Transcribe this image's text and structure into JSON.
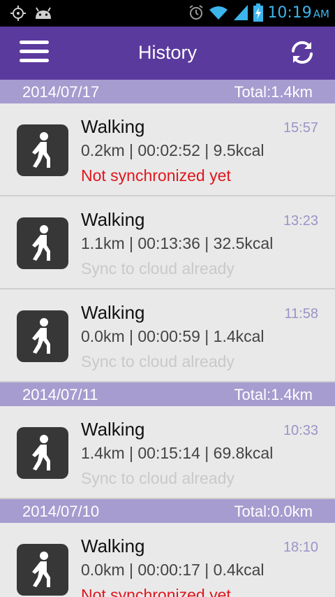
{
  "status_bar": {
    "time": "10:19",
    "ampm": "AM",
    "icons": [
      "gps-icon",
      "android-icon",
      "alarm-icon",
      "wifi-icon",
      "signal-icon",
      "battery-charging-icon"
    ]
  },
  "app_bar": {
    "title": "History",
    "menu_icon": "hamburger-menu-icon",
    "sync_icon": "refresh-sync-icon"
  },
  "colors": {
    "app_bar": "#5b3a9e",
    "day_header": "#a69ccf",
    "unsynced": "#e0161e",
    "synced": "#c9c9c9",
    "time_text": "#9c93c6"
  },
  "days": [
    {
      "date": "2014/07/17",
      "total": "Total:1.4km",
      "records": [
        {
          "activity": "Walking",
          "time": "15:57",
          "stats": "0.2km | 00:02:52 | 9.5kcal",
          "sync": "Not synchronized yet",
          "synced": false
        },
        {
          "activity": "Walking",
          "time": "13:23",
          "stats": "1.1km | 00:13:36 | 32.5kcal",
          "sync": "Sync to cloud already",
          "synced": true
        },
        {
          "activity": "Walking",
          "time": "11:58",
          "stats": "0.0km | 00:00:59 | 1.4kcal",
          "sync": "Sync to cloud already",
          "synced": true
        }
      ]
    },
    {
      "date": "2014/07/11",
      "total": "Total:1.4km",
      "records": [
        {
          "activity": "Walking",
          "time": "10:33",
          "stats": "1.4km | 00:15:14 | 69.8kcal",
          "sync": "Sync to cloud already",
          "synced": true
        }
      ]
    },
    {
      "date": "2014/07/10",
      "total": "Total:0.0km",
      "records": [
        {
          "activity": "Walking",
          "time": "18:10",
          "stats": "0.0km | 00:00:17 | 0.4kcal",
          "sync": "Not synchronized yet",
          "synced": false
        }
      ]
    }
  ]
}
